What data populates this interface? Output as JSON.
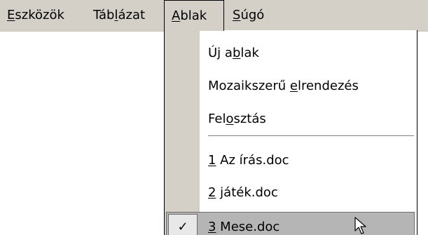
{
  "menubar": {
    "items": [
      {
        "pre": "",
        "acc": "E",
        "post": "szközök"
      },
      {
        "pre": "Táb",
        "acc": "l",
        "post": "ázat"
      },
      {
        "pre": "",
        "acc": "A",
        "post": "blak"
      },
      {
        "pre": "",
        "acc": "S",
        "post": "úgó"
      }
    ]
  },
  "ablak_menu": {
    "items": [
      {
        "pre": "Új a",
        "acc": "b",
        "post": "lak"
      },
      {
        "pre": "Mozaikszerű ",
        "acc": "e",
        "post": "lrendezés"
      },
      {
        "pre": "Fel",
        "acc": "o",
        "post": "sztás"
      },
      {
        "pre": "",
        "acc": "1",
        "post": " Az írás.doc"
      },
      {
        "pre": "",
        "acc": "2",
        "post": " játék.doc"
      },
      {
        "pre": "",
        "acc": "3",
        "post": " Mese.doc",
        "checked": true,
        "check_mark": "✓"
      }
    ]
  },
  "colors": {
    "menu_face": "#d4d0c8",
    "selected_bg": "#b5b5b5",
    "border": "#000000"
  },
  "icons": {
    "check": "check-icon",
    "cursor": "mouse-pointer-icon"
  }
}
